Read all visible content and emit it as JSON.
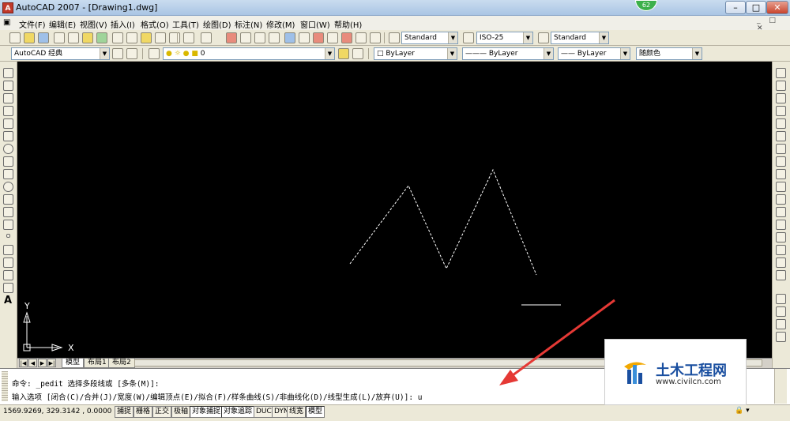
{
  "window": {
    "title": "AutoCAD 2007 - [Drawing1.dwg]",
    "app_icon": "A",
    "badge": "62",
    "min": "–",
    "max": "□",
    "close": "✕",
    "doc_controls": "_ □ ✕"
  },
  "menu": [
    "文件(F)",
    "编辑(E)",
    "视图(V)",
    "插入(I)",
    "格式(O)",
    "工具(T)",
    "绘图(D)",
    "标注(N)",
    "修改(M)",
    "窗口(W)",
    "帮助(H)"
  ],
  "toolbar1": {
    "text_style": "Standard",
    "dim_style": "ISO-25",
    "table_style": "Standard"
  },
  "toolbar2": {
    "workspace": "AutoCAD 经典",
    "layer": "0",
    "color": "ByLayer",
    "linetype": "ByLayer",
    "lineweight": "ByLayer",
    "plotstyle": "随颜色"
  },
  "left_tool_text": "A",
  "ucs": {
    "y": "Y",
    "x": "X"
  },
  "tabs": {
    "nav": [
      "|◀",
      "◀",
      "▶",
      "▶|"
    ],
    "items": [
      "模型",
      "布局1",
      "布局2"
    ],
    "active": 0
  },
  "command": {
    "line1": "命令: _pedit 选择多段线或 [多条(M)]:",
    "line2": "输入选项 [闭合(C)/合并(J)/宽度(W)/编辑顶点(E)/拟合(F)/样条曲线(S)/非曲线化(D)/线型生成(L)/放弃(U)]: u"
  },
  "status": {
    "coords": "1569.9269, 329.3142 , 0.0000",
    "buttons": [
      "捕捉",
      "栅格",
      "正交",
      "极轴",
      "对象捕捉",
      "对象追踪",
      "DUCS",
      "DYN",
      "线宽",
      "模型"
    ],
    "on": [
      4,
      5,
      9
    ],
    "tray": "🔒 ▾"
  },
  "watermark": {
    "cn": "土木工程网",
    "url": "www.civilcn.com"
  },
  "colors": {
    "canvas": "#000000",
    "polyline": "#ffffff",
    "arrow": "#e53935"
  }
}
